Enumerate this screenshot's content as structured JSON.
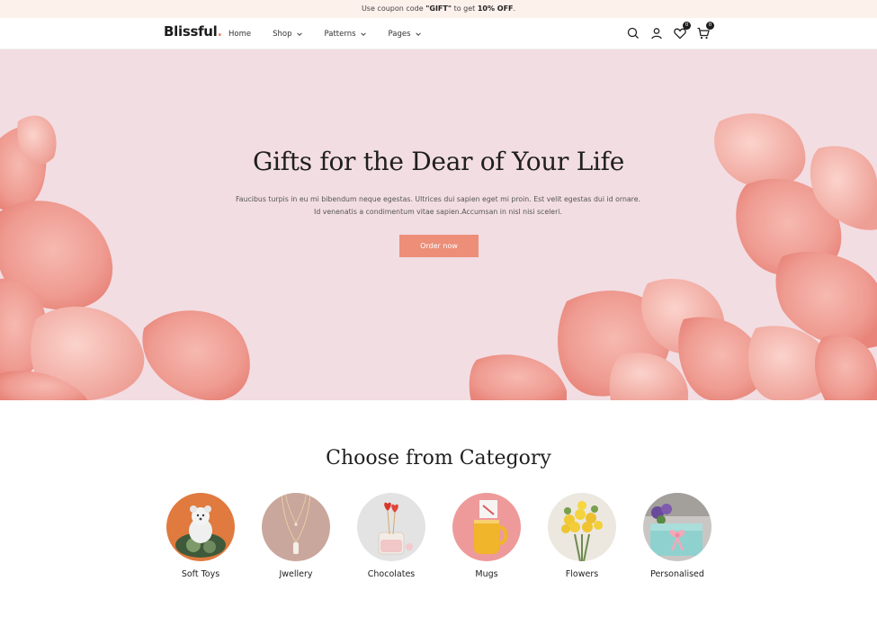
{
  "announcement": {
    "prefix": "Use coupon code ",
    "code": "\"GIFT\"",
    "middle": " to get ",
    "offer": "10% OFF",
    "suffix": "."
  },
  "header": {
    "logo": "Blissful",
    "logo_dot": ".",
    "nav": [
      {
        "label": "Home",
        "has_dropdown": false
      },
      {
        "label": "Shop",
        "has_dropdown": true
      },
      {
        "label": "Patterns",
        "has_dropdown": true
      },
      {
        "label": "Pages",
        "has_dropdown": true
      }
    ],
    "wishlist_count": "0",
    "cart_count": "0"
  },
  "hero": {
    "title": "Gifts for the Dear of Your Life",
    "description_line1": "Faucibus turpis in eu mi bibendum neque egestas. Ultrices dui sapien eget mi proin. Est velit egestas dui id ornare.",
    "description_line2": "Id venenatis a condimentum vitae sapien.Accumsan in nisl nisi sceleri.",
    "button": "Order now"
  },
  "categories_section": {
    "title": "Choose from Category",
    "items": [
      {
        "label": "Soft Toys",
        "bg": "#e07a3e"
      },
      {
        "label": "Jwellery",
        "bg": "#c9a79c"
      },
      {
        "label": "Chocolates",
        "bg": "#e3e3e3"
      },
      {
        "label": "Mugs",
        "bg": "#ee9a9a"
      },
      {
        "label": "Flowers",
        "bg": "#ece7df"
      },
      {
        "label": "Personalised",
        "bg": "#c9c6c4"
      }
    ]
  },
  "colors": {
    "accent": "#ec8e78",
    "topbar_bg": "#fdf1ec",
    "hero_bg": "#f2dde2",
    "petal": "#f2a39a"
  }
}
